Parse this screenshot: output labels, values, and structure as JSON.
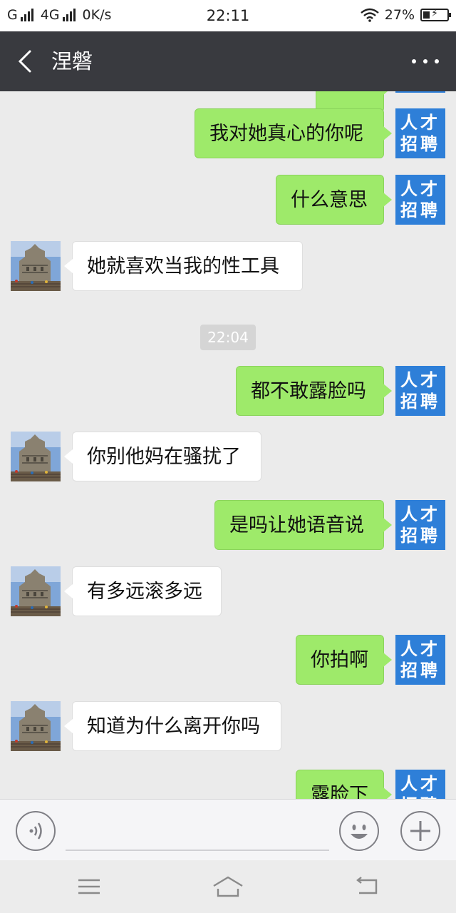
{
  "status_bar": {
    "carrier1": "G",
    "network": "4G",
    "speed": "0K/s",
    "time": "22:11",
    "battery": "27%",
    "battery_level": 0.27,
    "icons": [
      "signal-icon",
      "signal-icon",
      "wifi-icon",
      "battery-charging-icon"
    ]
  },
  "nav": {
    "title": "涅磐",
    "back_icon": "back-chevron-icon",
    "more_icon": "more-dots-icon"
  },
  "chat": {
    "self_avatar_text": [
      "人才",
      "招聘"
    ],
    "messages": [
      {
        "from": "self",
        "text": "我对她真心的你呢"
      },
      {
        "from": "self",
        "text": "什么意思"
      },
      {
        "from": "other",
        "text": "她就喜欢当我的性工具"
      },
      {
        "type": "time",
        "text": "22:04"
      },
      {
        "from": "self",
        "text": "都不敢露脸吗"
      },
      {
        "from": "other",
        "text": "你别他妈在骚扰了"
      },
      {
        "from": "self",
        "text": "是吗让她语音说"
      },
      {
        "from": "other",
        "text": "有多远滚多远"
      },
      {
        "from": "self",
        "text": "你拍啊"
      },
      {
        "from": "other",
        "text": "知道为什么离开你吗"
      },
      {
        "from": "self",
        "text": "露脸下"
      }
    ]
  },
  "input_bar": {
    "voice_icon": "voice-icon",
    "emoji_icon": "emoji-icon",
    "plus_icon": "plus-icon"
  },
  "system_nav": {
    "icons": [
      "menu-icon",
      "home-icon",
      "back-icon"
    ]
  },
  "colors": {
    "nav_bg": "#393a3f",
    "chat_bg": "#ebebeb",
    "self_bubble": "#9eea6a",
    "other_bubble": "#ffffff",
    "avatar_blue": "#2e7fd8"
  }
}
